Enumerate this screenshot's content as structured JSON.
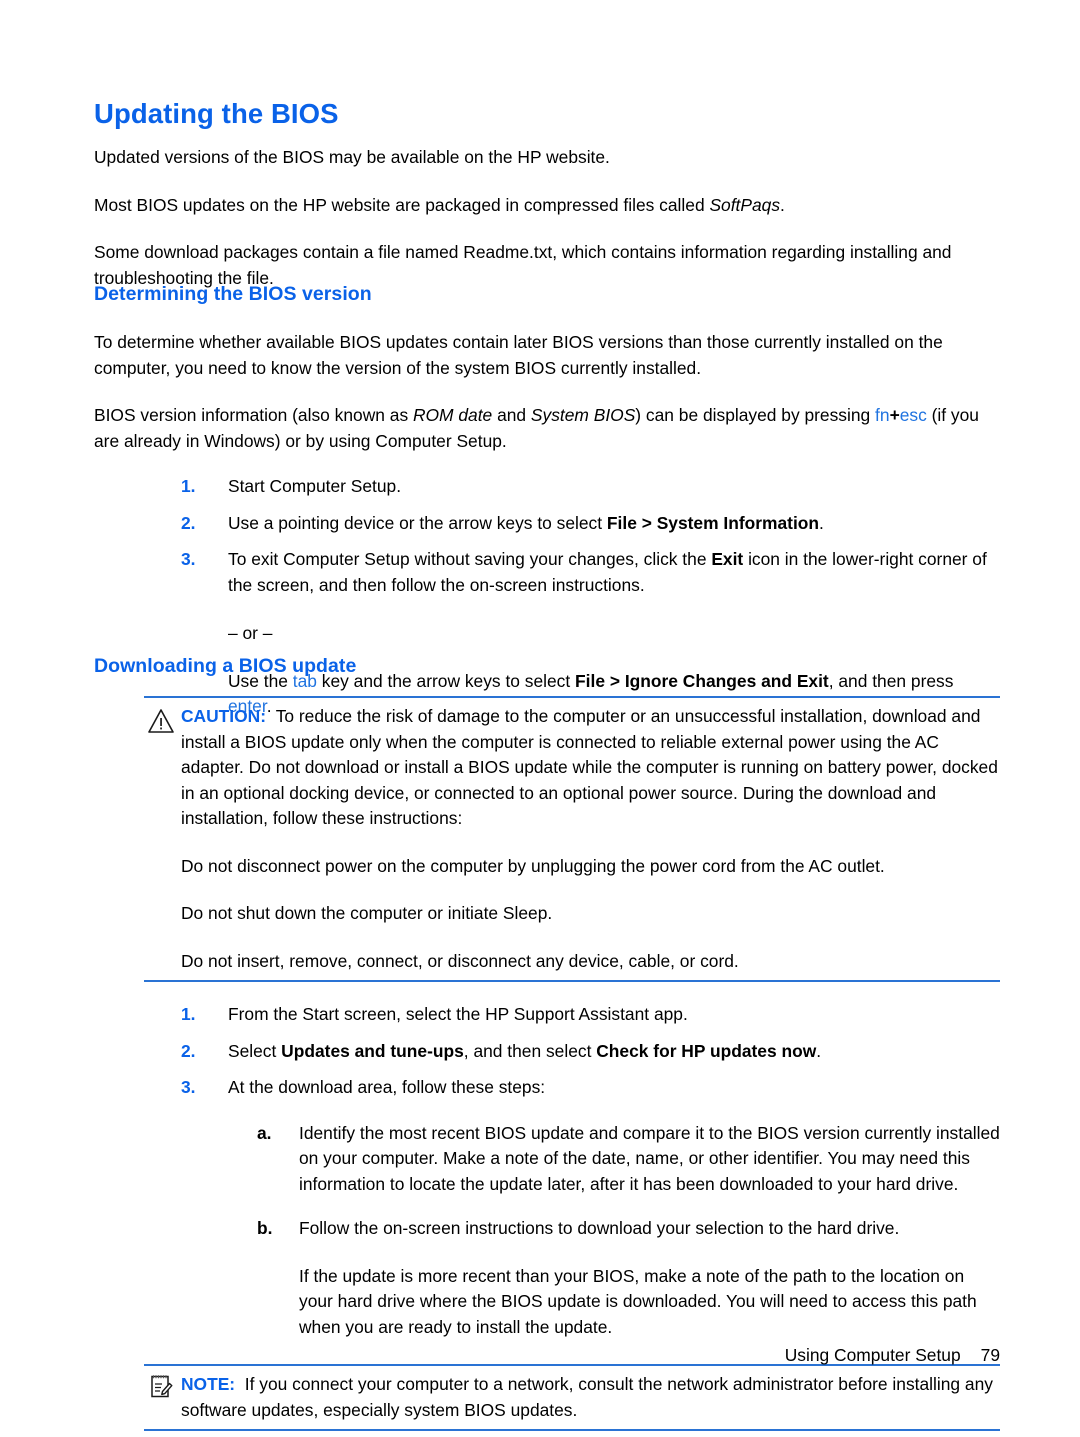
{
  "page": {
    "title": "Updating the BIOS",
    "accent_color": "#0a62e8",
    "rule_color": "#2a73d4"
  },
  "intro": {
    "p1": "Updated versions of the BIOS may be available on the HP website.",
    "p2_before": "Most BIOS updates on the HP website are packaged in compressed files called ",
    "p2_italic": "SoftPaqs",
    "p2_after": ".",
    "p3": "Some download packages contain a file named Readme.txt, which contains information regarding installing and troubleshooting the file."
  },
  "section_determining": {
    "heading": "Determining the BIOS version",
    "p1": "To determine whether available BIOS updates contain later BIOS versions than those currently installed on the computer, you need to know the version of the system BIOS currently installed.",
    "p2_a": "BIOS version information (also known as ",
    "p2_i1": "ROM date",
    "p2_b": " and ",
    "p2_i2": "System BIOS",
    "p2_c": ") can be displayed by pressing ",
    "key_fn": "fn",
    "key_plus": "+",
    "key_esc": "esc",
    "p2_d": " (if you are already in Windows) or by using Computer Setup.",
    "steps": [
      {
        "marker": "1.",
        "text": "Start Computer Setup."
      },
      {
        "marker": "2.",
        "text_a": "Use a pointing device or the arrow keys to select ",
        "bold": "File > System Information",
        "text_b": "."
      },
      {
        "marker": "3.",
        "text_a": "To exit Computer Setup without saving your changes, click the ",
        "bold": "Exit",
        "text_b": " icon in the lower-right corner of the screen, and then follow the on-screen instructions.",
        "or_text": "– or –",
        "alt_a": "Use the ",
        "alt_key1": "tab",
        "alt_b": " key and the arrow keys to select ",
        "alt_bold": "File > Ignore Changes and Exit",
        "alt_c": ", and then press ",
        "alt_key2": "enter",
        "alt_d": "."
      }
    ]
  },
  "section_downloading": {
    "heading": "Downloading a BIOS update",
    "caution": {
      "icon": "warning-triangle-icon",
      "label": "CAUTION:",
      "text": "To reduce the risk of damage to the computer or an unsuccessful installation, download and install a BIOS update only when the computer is connected to reliable external power using the AC adapter. Do not download or install a BIOS update while the computer is running on battery power, docked in an optional docking device, or connected to an optional power source. During the download and installation, follow these instructions:",
      "bullets": [
        "Do not disconnect power on the computer by unplugging the power cord from the AC outlet.",
        "Do not shut down the computer or initiate Sleep.",
        "Do not insert, remove, connect, or disconnect any device, cable, or cord."
      ]
    },
    "steps": [
      {
        "marker": "1.",
        "text": "From the Start screen, select the HP Support Assistant app."
      },
      {
        "marker": "2.",
        "text_a": "Select ",
        "bold1": "Updates and tune-ups",
        "text_b": ", and then select ",
        "bold2": "Check for HP updates now",
        "text_c": "."
      },
      {
        "marker": "3.",
        "text": "At the download area, follow these steps:",
        "substeps": [
          {
            "marker": "a.",
            "text": "Identify the most recent BIOS update and compare it to the BIOS version currently installed on your computer. Make a note of the date, name, or other identifier. You may need this information to locate the update later, after it has been downloaded to your hard drive."
          },
          {
            "marker": "b.",
            "text": "Follow the on-screen instructions to download your selection to the hard drive.",
            "extra": "If the update is more recent than your BIOS, make a note of the path to the location on your hard drive where the BIOS update is downloaded. You will need to access this path when you are ready to install the update."
          }
        ]
      }
    ],
    "note": {
      "icon": "notepad-pencil-icon",
      "label": "NOTE:",
      "text": "If you connect your computer to a network, consult the network administrator before installing any software updates, especially system BIOS updates."
    }
  },
  "footer": {
    "text": "Using Computer Setup",
    "page_number": "79"
  }
}
